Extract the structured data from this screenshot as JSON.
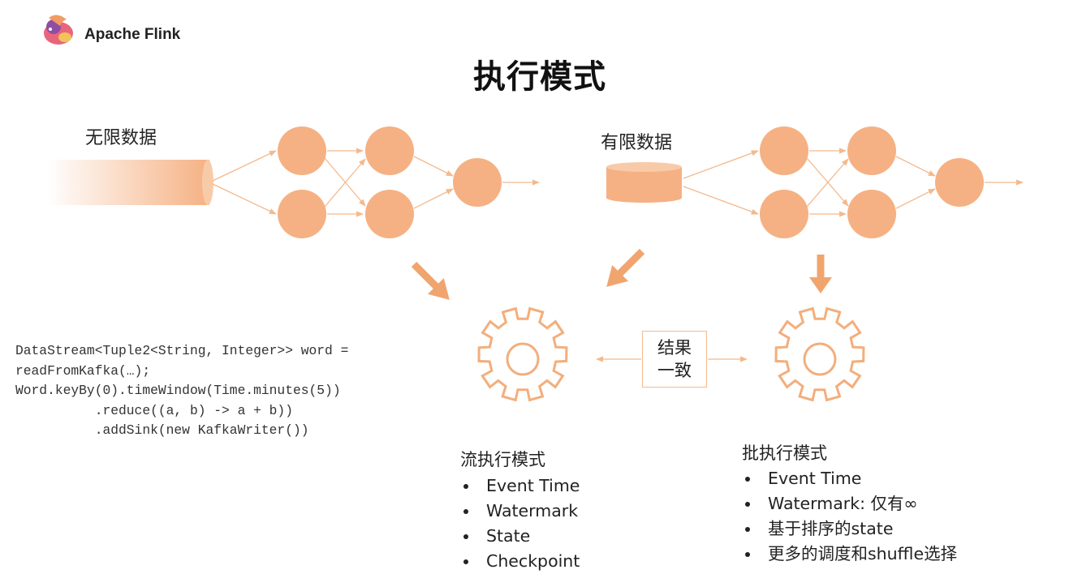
{
  "brand": {
    "name": "Apache Flink",
    "logo_icon": "squirrel-logo-icon"
  },
  "title": "执行模式",
  "colors": {
    "node": "#f5b183",
    "arrow": "#f4b98c",
    "big_arrow": "#f0a56f",
    "gear": "#f3ae7c",
    "text": "#222222"
  },
  "unbounded": {
    "label": "无限数据",
    "icon": "stream-cylinder-icon"
  },
  "bounded": {
    "label": "有限数据",
    "icon": "database-disk-icon"
  },
  "result_box": {
    "line1": "结果",
    "line2": "一致"
  },
  "code": "DataStream<Tuple2<String, Integer>> word =\nreadFromKafka(…);\nWord.keyBy(0).timeWindow(Time.minutes(5))\n          .reduce((a, b) -> a + b))\n          .addSink(new KafkaWriter())",
  "stream_mode": {
    "title": "流执行模式",
    "items": [
      "Event Time",
      "Watermark",
      "State",
      "Checkpoint"
    ]
  },
  "batch_mode": {
    "title": "批执行模式",
    "items": [
      "Event Time",
      "Watermark: 仅有∞",
      "基于排序的state",
      "更多的调度和shuffle选择"
    ]
  }
}
